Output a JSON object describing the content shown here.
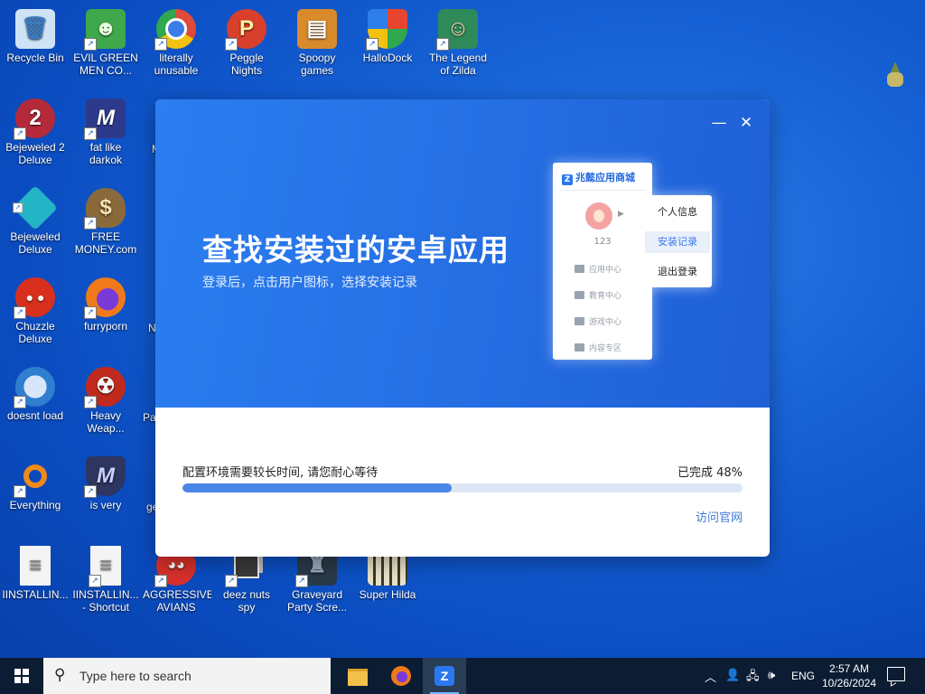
{
  "desktop_icons": [
    {
      "label": "Recycle Bin",
      "bg": "#cfe3f7",
      "glyph": "🗑",
      "shortcut": false
    },
    {
      "label": "EVIL GREEN MEN CO...",
      "bg": "#3ea84a",
      "glyph": "☻",
      "shortcut": true
    },
    {
      "label": "literally unusable",
      "bg": "#e04a3a",
      "glyph": "◉",
      "shortcut": true
    },
    {
      "label": "Peggle Nights Deluxe",
      "bg": "#d8402c",
      "glyph": "P",
      "shortcut": true
    },
    {
      "label": "Spoopy games",
      "bg": "#d98b2b",
      "glyph": "▤",
      "shortcut": false
    },
    {
      "label": "HalloDock",
      "bg": "#e8b520",
      "glyph": "⊞",
      "shortcut": true
    },
    {
      "label": "The Legend of Zilda",
      "bg": "#2f8a5a",
      "glyph": "☺",
      "shortcut": true
    },
    {
      "label": "Bejeweled 2 Deluxe",
      "bg": "#b42a3a",
      "glyph": "2",
      "shortcut": true
    },
    {
      "label": "fat like darkok",
      "bg": "#2d3a8c",
      "glyph": "M",
      "shortcut": true
    },
    {
      "label": "Bejeweled Deluxe",
      "bg": "#23b5c6",
      "glyph": "◆",
      "shortcut": true
    },
    {
      "label": "FREE MONEY.com",
      "bg": "#8a6a3a",
      "glyph": "$",
      "shortcut": true
    },
    {
      "label": "Chuzzle Deluxe",
      "bg": "#d8301c",
      "glyph": "●",
      "shortcut": true
    },
    {
      "label": "furryporn",
      "bg": "#f07a1a",
      "glyph": "◐",
      "shortcut": true
    },
    {
      "label": "doesnt load",
      "bg": "#2f7ed0",
      "glyph": "✉",
      "shortcut": true
    },
    {
      "label": "Heavy Weap...",
      "bg": "#c02a1e",
      "glyph": "☢",
      "shortcut": true
    },
    {
      "label": "Everything",
      "bg": "#f08a1a",
      "glyph": "○",
      "shortcut": true
    },
    {
      "label": "is very",
      "bg": "#2d3560",
      "glyph": "M",
      "shortcut": true
    },
    {
      "label": "IINSTALLIN...",
      "bg": "#f4f4f4",
      "glyph": "≡",
      "shortcut": false
    },
    {
      "label": "IINSTALLIN... - Shortcut",
      "bg": "#f4f4f4",
      "glyph": "≡",
      "shortcut": true
    },
    {
      "label": "AGGRESSIVE AVIANS",
      "bg": "#d8302a",
      "glyph": "◕",
      "shortcut": true
    },
    {
      "label": "deez nuts spy",
      "bg": "#3a3a3a",
      "glyph": "▣",
      "shortcut": true
    },
    {
      "label": "Graveyard Party Scre...",
      "bg": "#2a3a4a",
      "glyph": "♜",
      "shortcut": true
    },
    {
      "label": "Super Hilda",
      "bg": "#e8e2c8",
      "glyph": "▦",
      "shortcut": false
    }
  ],
  "partial_labels": [
    "M",
    "N",
    "Pa",
    "ge"
  ],
  "dialog": {
    "minimize_glyph": "—",
    "close_glyph": "✕",
    "banner_title": "查找安装过的安卓应用",
    "banner_subtitle": "登录后，点击用户图标，选择安装记录",
    "store": {
      "name": "兆懿应用商城",
      "username": "123",
      "menu": [
        "应用中心",
        "教育中心",
        "游戏中心",
        "内容专区"
      ]
    },
    "popup_menu": [
      "个人信息",
      "安装记录",
      "退出登录"
    ],
    "status_text": "配置环境需要较长时间, 请您耐心等待",
    "progress_label": "已完成 48%",
    "progress_value": 0.48,
    "visit_link": "访问官网"
  },
  "taskbar": {
    "search_placeholder": "Type here to search",
    "language": "ENG",
    "time": "2:57 AM",
    "date": "10/26/2024"
  },
  "colors": {
    "accent": "#4a86e6",
    "banner": "#2672e6",
    "taskbar": "#0c1d33"
  }
}
